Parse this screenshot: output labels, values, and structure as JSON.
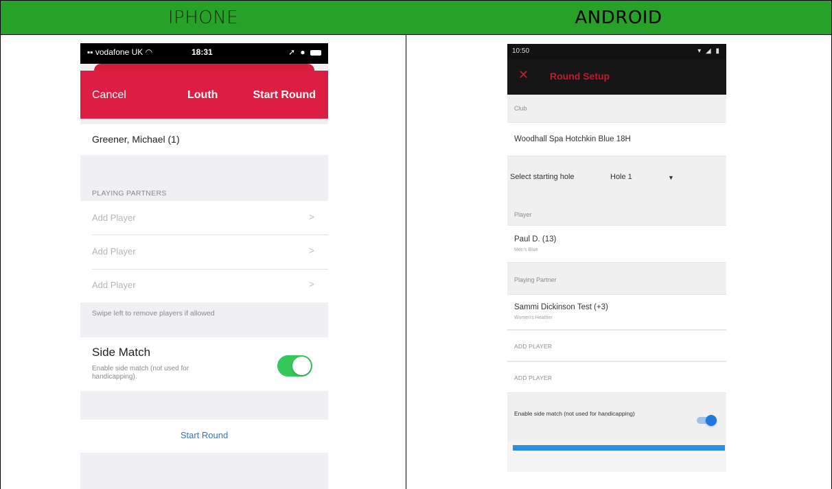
{
  "table": {
    "left_header": "IPHONE",
    "right_header": "ANDROID",
    "header_color": "#27a127"
  },
  "iphone": {
    "status": {
      "carrier": "vodafone UK",
      "time": "18:31"
    },
    "nav": {
      "cancel": "Cancel",
      "title": "Louth",
      "start": "Start Round",
      "color": "#dc1e42"
    },
    "player": "Greener, Michael (1)",
    "partners_header": "PLAYING PARTNERS",
    "add_players": [
      "Add Player",
      "Add Player",
      "Add Player"
    ],
    "chevron": ">",
    "footer_note": "Swipe left to remove players if allowed",
    "side_match": {
      "title": "Side Match",
      "subtitle": "Enable side match (not used for handicapping).",
      "enabled": true,
      "toggle_color": "#34c759"
    },
    "start_button": "Start Round"
  },
  "android": {
    "status": {
      "time": "10:50"
    },
    "toolbar": {
      "close": "✕",
      "title": "Round Setup"
    },
    "club_label": "Club",
    "club_value": "Woodhall Spa Hotchkin Blue 18H",
    "starting_hole": {
      "label": "Select starting hole",
      "value": "Hole 1",
      "arrow": "▼"
    },
    "player_label": "Player",
    "player": {
      "name": "Paul D. (13)",
      "tee": "Men's Blue"
    },
    "partner_label": "Playing Partner",
    "partner": {
      "name": "Sammi Dickinson Test (+3)",
      "tee": "Women's Heather"
    },
    "add_players": [
      "ADD PLAYER",
      "ADD PLAYER"
    ],
    "side_match": {
      "text": "Enable side match (not used for handicapping)",
      "enabled": true,
      "toggle_color": "#1e7ae0"
    }
  }
}
